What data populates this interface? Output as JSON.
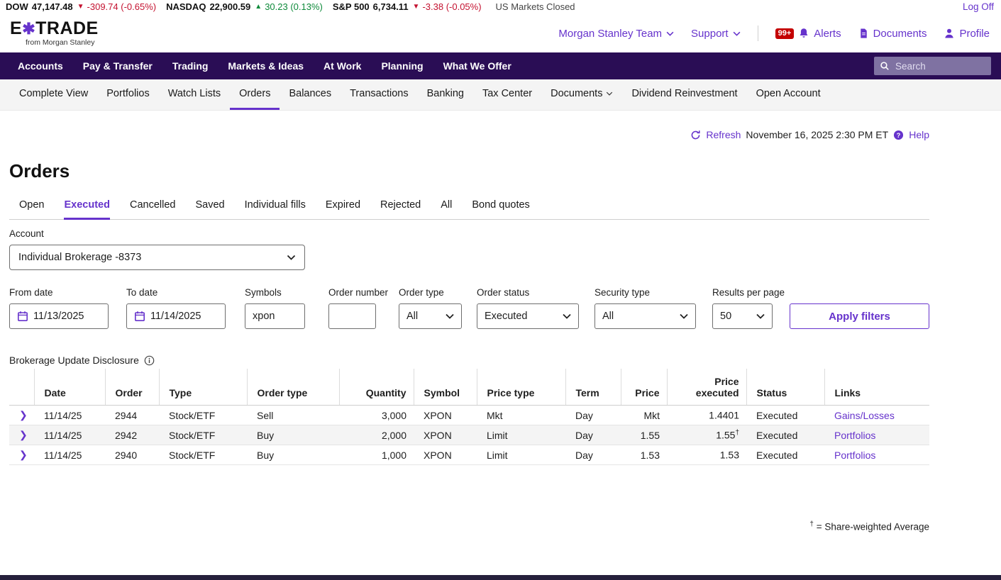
{
  "ticker": {
    "items": [
      {
        "label": "DOW",
        "value": "47,147.48",
        "direction": "down",
        "arrow": "▼",
        "change": "-309.74 (-0.65%)"
      },
      {
        "label": "NASDAQ",
        "value": "22,900.59",
        "direction": "up",
        "arrow": "▲",
        "change": "30.23 (0.13%)"
      },
      {
        "label": "S&P 500",
        "value": "6,734.11",
        "direction": "down",
        "arrow": "▼",
        "change": "-3.38 (-0.05%)"
      }
    ],
    "market_status": "US Markets Closed",
    "log_off": "Log Off"
  },
  "header": {
    "logo_prefix": "E",
    "logo_star": "✱",
    "logo_suffix": "TRADE",
    "logo_sub": "from Morgan Stanley",
    "team": "Morgan Stanley Team",
    "support": "Support",
    "alerts_badge": "99+",
    "alerts": "Alerts",
    "documents": "Documents",
    "profile": "Profile"
  },
  "main_nav": {
    "items": [
      "Accounts",
      "Pay & Transfer",
      "Trading",
      "Markets & Ideas",
      "At Work",
      "Planning",
      "What We Offer"
    ],
    "search_placeholder": "Search"
  },
  "sub_nav": {
    "items": [
      "Complete View",
      "Portfolios",
      "Watch Lists",
      "Orders",
      "Balances",
      "Transactions",
      "Banking",
      "Tax Center",
      "Documents",
      "Dividend Reinvestment",
      "Open Account"
    ],
    "active": "Orders"
  },
  "refresh_bar": {
    "refresh": "Refresh",
    "timestamp": "November 16, 2025 2:30 PM ET",
    "help": "Help"
  },
  "page": {
    "title": "Orders"
  },
  "tabs": {
    "items": [
      "Open",
      "Executed",
      "Cancelled",
      "Saved",
      "Individual fills",
      "Expired",
      "Rejected",
      "All",
      "Bond quotes"
    ],
    "active": "Executed"
  },
  "account": {
    "label": "Account",
    "selected": "Individual Brokerage -8373"
  },
  "filters": {
    "from_date": {
      "label": "From date",
      "value": "11/13/2025"
    },
    "to_date": {
      "label": "To date",
      "value": "11/14/2025"
    },
    "symbols": {
      "label": "Symbols",
      "value": "xpon"
    },
    "order_number": {
      "label": "Order number",
      "value": ""
    },
    "order_type": {
      "label": "Order type",
      "value": "All"
    },
    "order_status": {
      "label": "Order status",
      "value": "Executed"
    },
    "security_type": {
      "label": "Security type",
      "value": "All"
    },
    "results_per_page": {
      "label": "Results per page",
      "value": "50"
    },
    "apply": "Apply filters"
  },
  "disclosure": {
    "text": "Brokerage Update Disclosure"
  },
  "table": {
    "headers": [
      "Date",
      "Order",
      "Type",
      "Order type",
      "Quantity",
      "Symbol",
      "Price type",
      "Term",
      "Price",
      "Price executed",
      "Status",
      "Links"
    ],
    "rows": [
      {
        "date": "11/14/25",
        "order": "2944",
        "type": "Stock/ETF",
        "order_type": "Sell",
        "quantity": "3,000",
        "symbol": "XPON",
        "price_type": "Mkt",
        "term": "Day",
        "price": "Mkt",
        "price_executed": "1.4401",
        "dagger": "",
        "status": "Executed",
        "link": "Gains/Losses"
      },
      {
        "date": "11/14/25",
        "order": "2942",
        "type": "Stock/ETF",
        "order_type": "Buy",
        "quantity": "2,000",
        "symbol": "XPON",
        "price_type": "Limit",
        "term": "Day",
        "price": "1.55",
        "price_executed": "1.55",
        "dagger": "†",
        "status": "Executed",
        "link": "Portfolios"
      },
      {
        "date": "11/14/25",
        "order": "2940",
        "type": "Stock/ETF",
        "order_type": "Buy",
        "quantity": "1,000",
        "symbol": "XPON",
        "price_type": "Limit",
        "term": "Day",
        "price": "1.53",
        "price_executed": "1.53",
        "dagger": "",
        "status": "Executed",
        "link": "Portfolios"
      }
    ]
  },
  "footnote": {
    "symbol": "†",
    "text": "= Share-weighted Average"
  }
}
